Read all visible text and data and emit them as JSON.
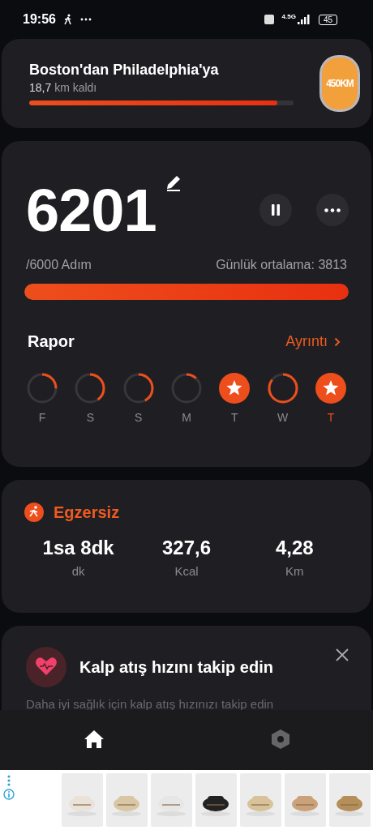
{
  "status_bar": {
    "time": "19:56",
    "battery": "45",
    "network": "4.5G"
  },
  "route": {
    "title": "Boston'dan Philadelphia'ya",
    "remaining_value": "18,7",
    "remaining_unit": "km kaldı",
    "level": 0.94,
    "badge": "450KM"
  },
  "steps": {
    "count": "6201",
    "goal": "/6000 Adım",
    "average": "Günlük ortalama: 3813",
    "level": 1
  },
  "report": {
    "title": "Rapor",
    "link": "Ayrıntı"
  },
  "days": [
    {
      "label": "F",
      "completed": false,
      "selected": false
    },
    {
      "label": "S",
      "completed": false,
      "selected": false
    },
    {
      "label": "S",
      "completed": false,
      "selected": false
    },
    {
      "label": "M",
      "completed": false,
      "selected": false
    },
    {
      "label": "T",
      "completed": true,
      "selected": false
    },
    {
      "label": "W",
      "completed": false,
      "selected": false
    },
    {
      "label": "T",
      "completed": true,
      "selected": true
    }
  ],
  "exercise": {
    "title": "Egzersiz",
    "stats": [
      {
        "value": "1sa 8dk",
        "unit": "dk"
      },
      {
        "value": "327,6",
        "unit": "Kcal"
      },
      {
        "value": "4,28",
        "unit": "Km"
      }
    ]
  },
  "heart_card": {
    "title": "Kalp atış hızını takip edin",
    "text": "Daha iyi sağlık için kalp atış hızınızı takip edin"
  },
  "nav": [
    {
      "kind": "home",
      "selected": true
    },
    {
      "kind": "settings",
      "selected": false
    }
  ]
}
